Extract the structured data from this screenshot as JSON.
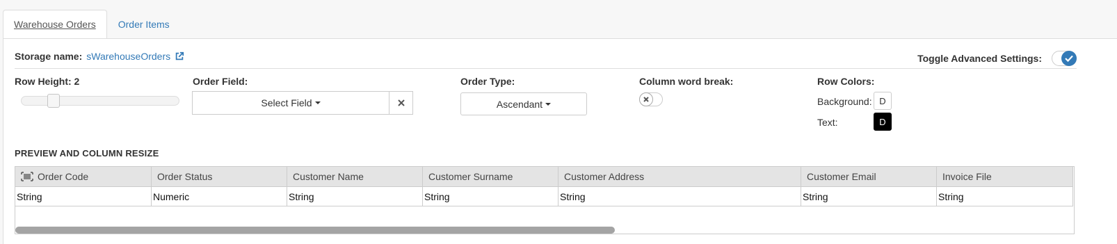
{
  "tabs": [
    {
      "label": "Warehouse Orders",
      "active": true
    },
    {
      "label": "Order Items",
      "active": false
    }
  ],
  "storage": {
    "label": "Storage name:",
    "name": "sWarehouseOrders"
  },
  "advanced": {
    "label": "Toggle Advanced Settings:",
    "enabled": true
  },
  "row_height": {
    "label": "Row Height: 2",
    "value": 2
  },
  "order_field": {
    "label": "Order Field:",
    "button": "Select Field"
  },
  "order_type": {
    "label": "Order Type:",
    "button": "Ascendant"
  },
  "word_break": {
    "label": "Column word break:",
    "enabled": false
  },
  "row_colors": {
    "label": "Row Colors:",
    "background_label": "Background:",
    "background_value": "D",
    "text_label": "Text:",
    "text_value": "D"
  },
  "preview": {
    "title": "PREVIEW AND COLUMN RESIZE",
    "columns": [
      "Order Code",
      "Order Status",
      "Customer Name",
      "Customer Surname",
      "Customer Address",
      "Customer Email",
      "Invoice File"
    ],
    "types": [
      "String",
      "Numeric",
      "String",
      "String",
      "String",
      "String",
      "String"
    ]
  },
  "colors": {
    "accent": "#337ab7",
    "header_bg": "#e4e4e4",
    "black_swatch": "#000000"
  }
}
